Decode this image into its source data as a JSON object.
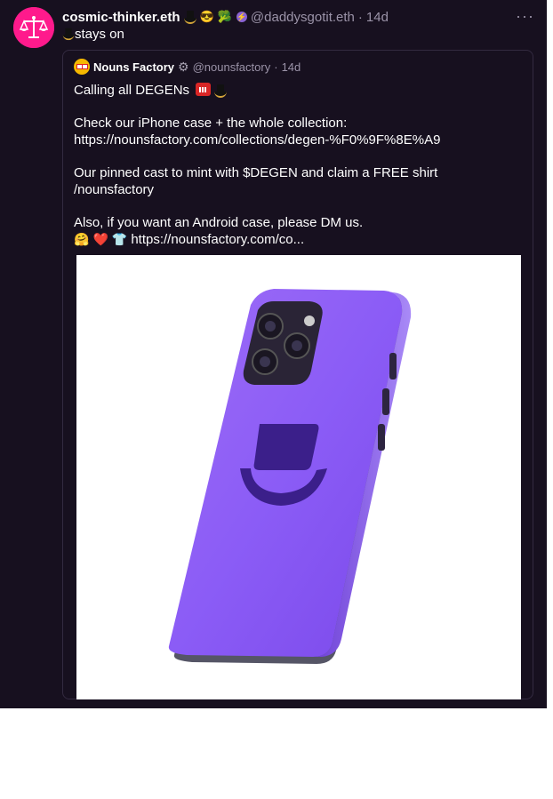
{
  "post": {
    "author_name": "cosmic-thinker.eth",
    "author_emojis": [
      "top-hat",
      "😎",
      "🥦"
    ],
    "handle": "@daddysgotit.eth",
    "separator": "·",
    "timestamp": "14d",
    "menu_label": "···",
    "body_icon": "top-hat",
    "body_text": "stays on"
  },
  "quoted_cast": {
    "author_name": "Nouns Factory",
    "author_badge": "⚙",
    "handle": "@nounsfactory",
    "separator": "·",
    "timestamp": "14d",
    "line1": "Calling all DEGENs",
    "line2": "Check our iPhone case + the whole collection:",
    "line3": "https://nounsfactory.com/collections/degen-%F0%9F%8E%A9",
    "line4": "Our pinned cast to mint with $DEGEN and claim a FREE shirt",
    "line5": "/nounsfactory",
    "line6": "Also, if you want an Android case, please DM us.",
    "line7_emojis": [
      "🤗",
      "❤️",
      "👕"
    ],
    "line7_link": "https://nounsfactory.com/co..."
  },
  "colors": {
    "background": "#17101f",
    "border": "#332a40",
    "text": "#ffffff",
    "muted": "#9b93a8",
    "avatar": "#ff1a8c",
    "phone_case": "#8b5cf6",
    "hat": "#3b1f8a"
  }
}
